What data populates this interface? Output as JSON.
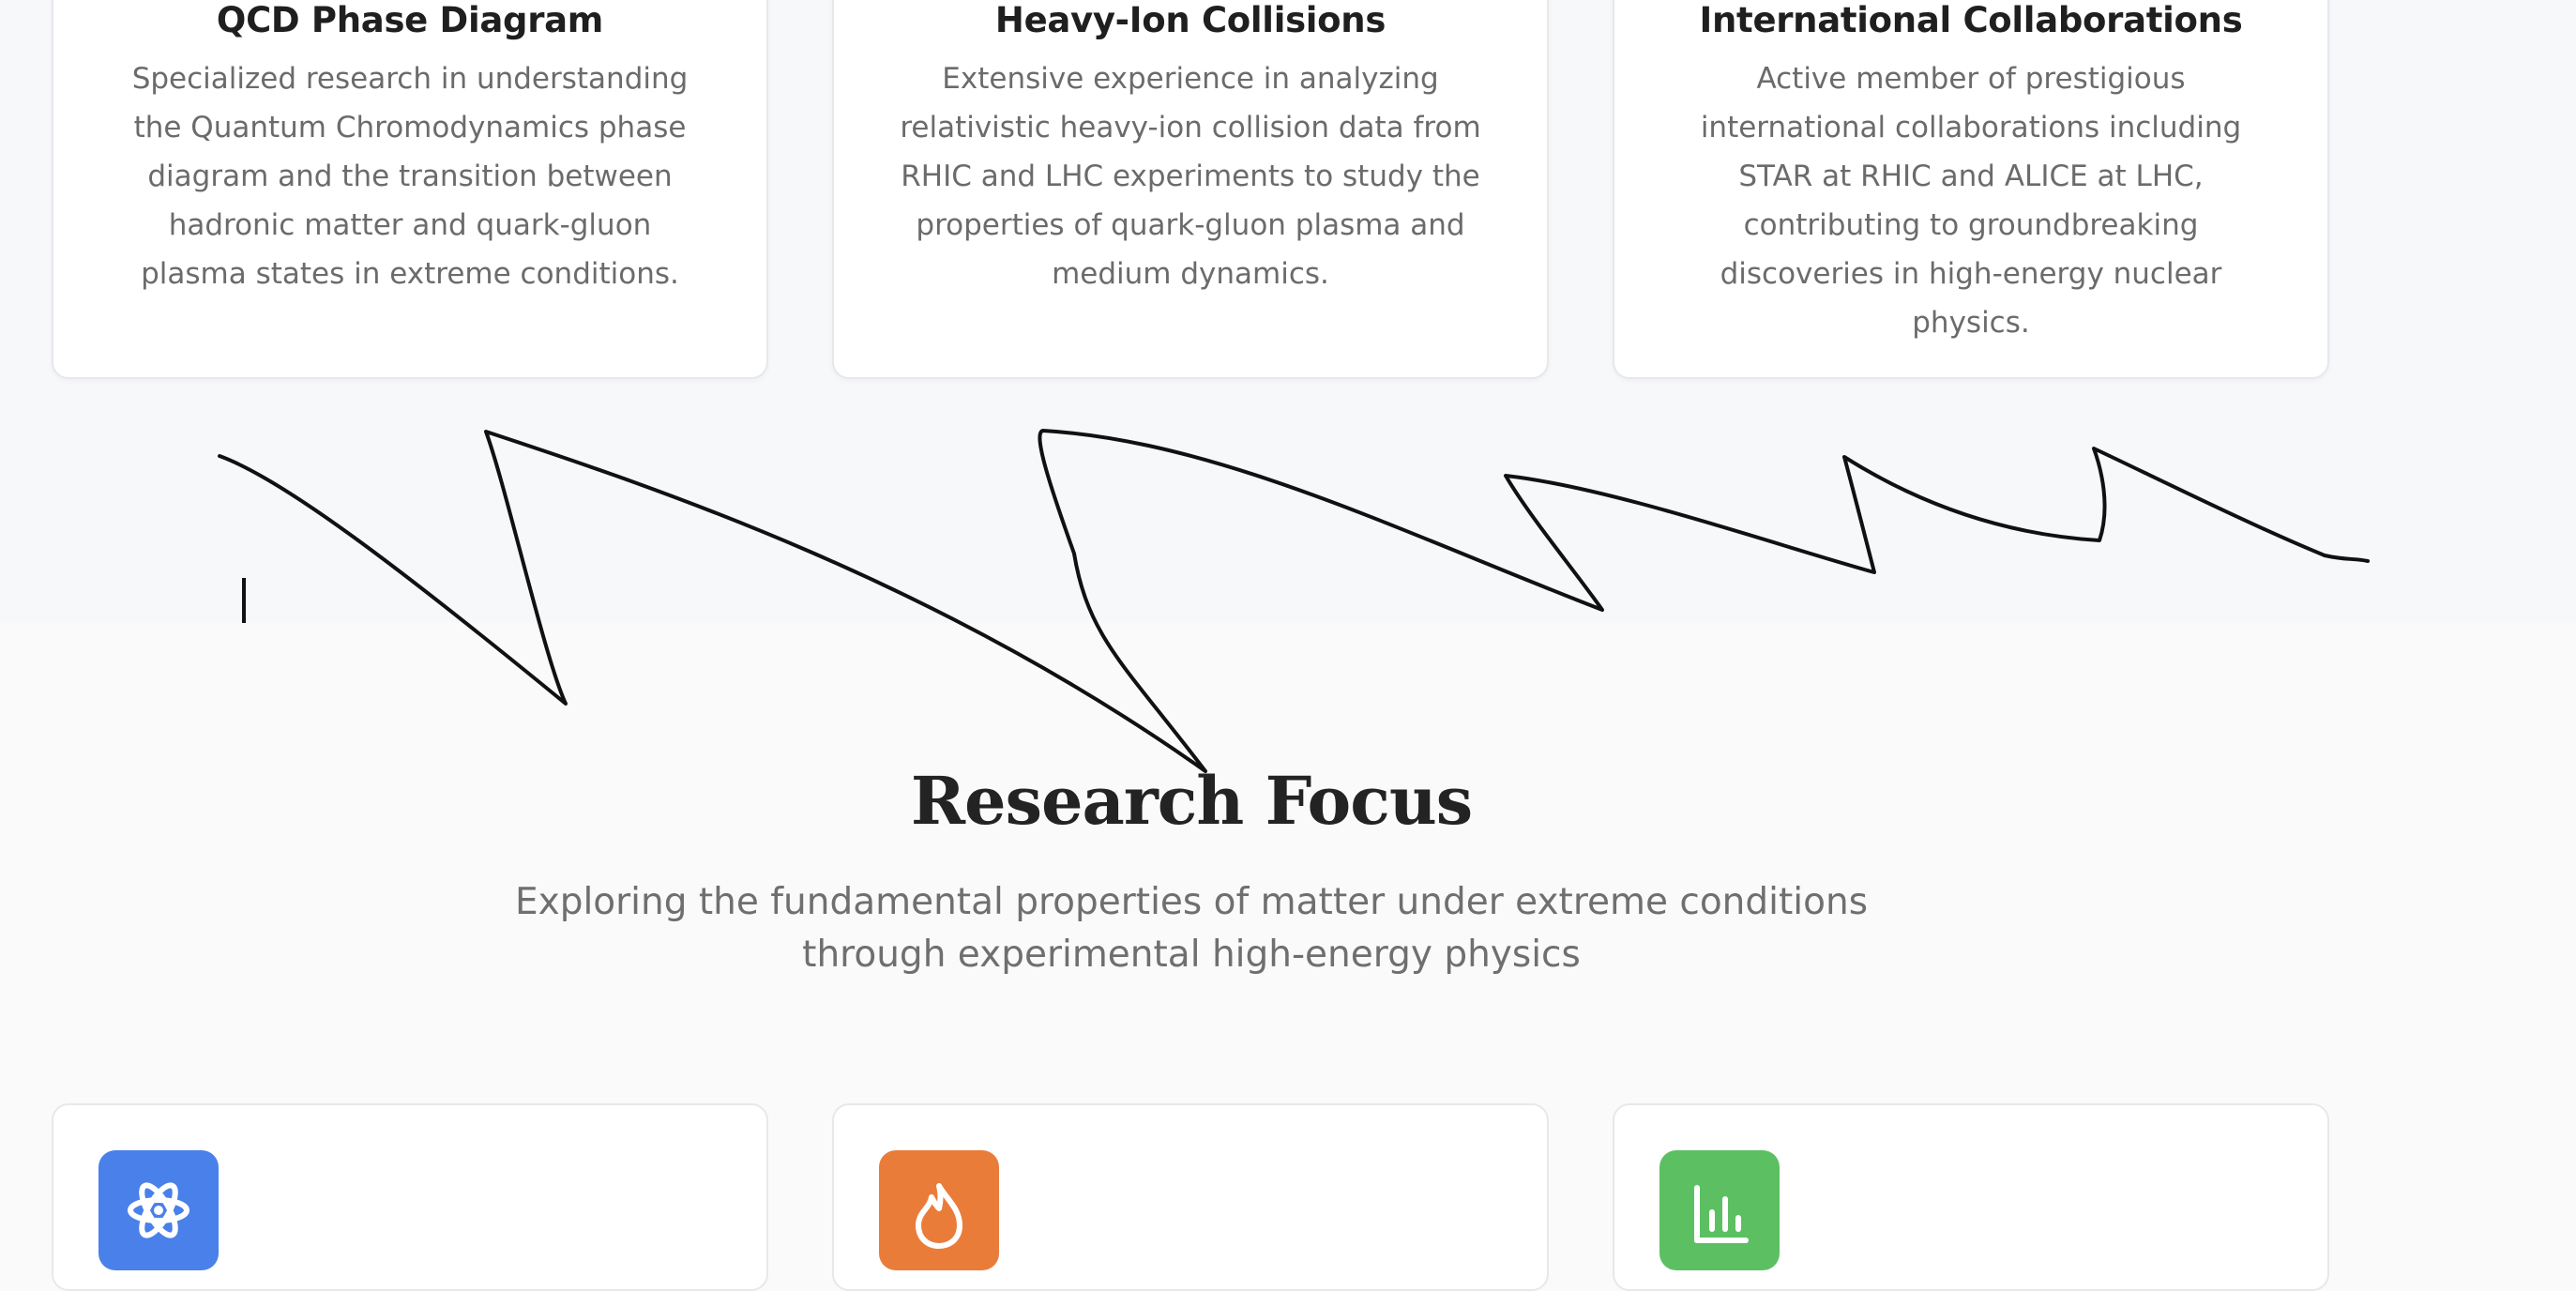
{
  "features": [
    {
      "title": "QCD Phase Diagram",
      "description": "Specialized research in understanding the Quantum Chromodynamics phase diagram and the transition between hadronic matter and quark-gluon plasma states in extreme conditions."
    },
    {
      "title": "Heavy-Ion Collisions",
      "description": "Extensive experience in analyzing relativistic heavy-ion collision data from RHIC and LHC experiments to study the properties of quark-gluon plasma and medium dynamics."
    },
    {
      "title": "International Collaborations",
      "description": "Active member of prestigious international collaborations including STAR at RHIC and ALICE at LHC, contributing to groundbreaking discoveries in high-energy nuclear physics."
    }
  ],
  "research": {
    "title": "Research Focus",
    "subtitle": "Exploring the fundamental properties of matter under extreme conditions through experimental high-energy physics"
  },
  "focus_cards": [
    {
      "icon": "atom-icon",
      "color": "#4a80ea"
    },
    {
      "icon": "flame-icon",
      "color": "#ea7c3a"
    },
    {
      "icon": "bar-chart-icon",
      "color": "#5cc063"
    }
  ]
}
